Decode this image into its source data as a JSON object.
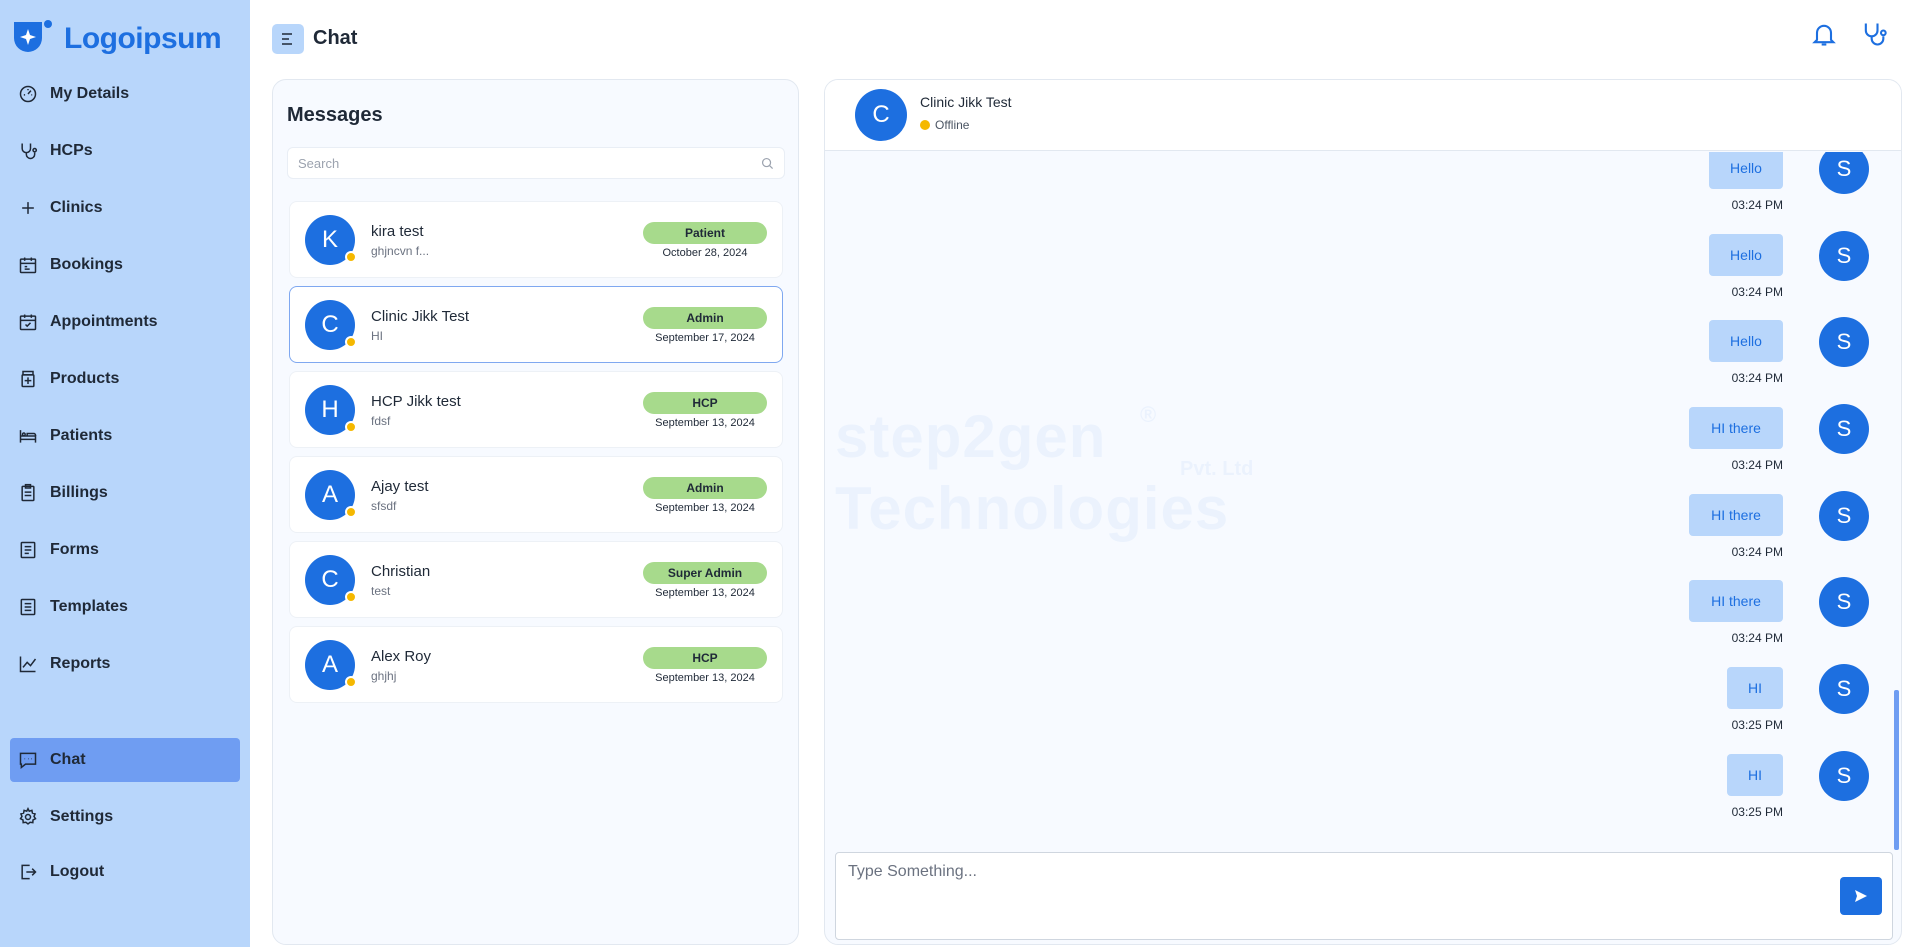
{
  "brand": {
    "logo_text": "Logoipsum"
  },
  "header": {
    "title": "Chat"
  },
  "sidebar": {
    "items": [
      {
        "label": "My Details",
        "icon": "gauge-icon"
      },
      {
        "label": "HCPs",
        "icon": "stethoscope-icon"
      },
      {
        "label": "Clinics",
        "icon": "plus-icon"
      },
      {
        "label": "Bookings",
        "icon": "calendar-icon"
      },
      {
        "label": "Appointments",
        "icon": "calendar-check-icon"
      },
      {
        "label": "Products",
        "icon": "medicine-icon"
      },
      {
        "label": "Patients",
        "icon": "bed-icon"
      },
      {
        "label": "Billings",
        "icon": "clipboard-icon"
      },
      {
        "label": "Forms",
        "icon": "form-icon"
      },
      {
        "label": "Templates",
        "icon": "template-icon"
      },
      {
        "label": "Reports",
        "icon": "chart-line-icon"
      },
      {
        "label": "Chat",
        "icon": "chat-icon",
        "active": true
      },
      {
        "label": "Settings",
        "icon": "gear-icon"
      },
      {
        "label": "Logout",
        "icon": "logout-icon"
      }
    ]
  },
  "messages": {
    "title": "Messages",
    "search_placeholder": "Search",
    "contacts": [
      {
        "initial": "K",
        "name": "kira test",
        "preview": "ghjncvn f...",
        "role": "Patient",
        "date": "October 28, 2024"
      },
      {
        "initial": "C",
        "name": "Clinic Jikk Test",
        "preview": "HI",
        "role": "Admin",
        "date": "September 17, 2024",
        "selected": true
      },
      {
        "initial": "H",
        "name": "HCP Jikk test",
        "preview": "fdsf",
        "role": "HCP",
        "date": "September 13, 2024"
      },
      {
        "initial": "A",
        "name": "Ajay test",
        "preview": "sfsdf",
        "role": "Admin",
        "date": "September 13, 2024"
      },
      {
        "initial": "C",
        "name": "Christian",
        "preview": "test",
        "role": "Super Admin",
        "date": "September 13, 2024"
      },
      {
        "initial": "A",
        "name": "Alex Roy",
        "preview": "ghjhj",
        "role": "HCP",
        "date": "September 13, 2024"
      }
    ]
  },
  "chat": {
    "contact_initial": "C",
    "contact_name": "Clinic Jikk Test",
    "status": "Offline",
    "watermark": {
      "line1": "step2gen",
      "reg": "®",
      "line2": "Technologies",
      "suffix": "Pvt. Ltd"
    },
    "messages": [
      {
        "text": "Hello",
        "time": "03:24 PM",
        "sender_initial": "S"
      },
      {
        "text": "Hello",
        "time": "03:24 PM",
        "sender_initial": "S"
      },
      {
        "text": "Hello",
        "time": "03:24 PM",
        "sender_initial": "S"
      },
      {
        "text": "HI there",
        "time": "03:24 PM",
        "sender_initial": "S"
      },
      {
        "text": "HI there",
        "time": "03:24 PM",
        "sender_initial": "S"
      },
      {
        "text": "HI there",
        "time": "03:24 PM",
        "sender_initial": "S"
      },
      {
        "text": "HI",
        "time": "03:25 PM",
        "sender_initial": "S"
      },
      {
        "text": "HI",
        "time": "03:25 PM",
        "sender_initial": "S"
      }
    ],
    "compose_placeholder": "Type Something..."
  },
  "colors": {
    "sidebar_bg": "#b8d6fb",
    "active_nav": "#6f9df2",
    "primary": "#1d6fe0",
    "role_badge": "#a7da8c",
    "status_offline": "#f5b800"
  }
}
